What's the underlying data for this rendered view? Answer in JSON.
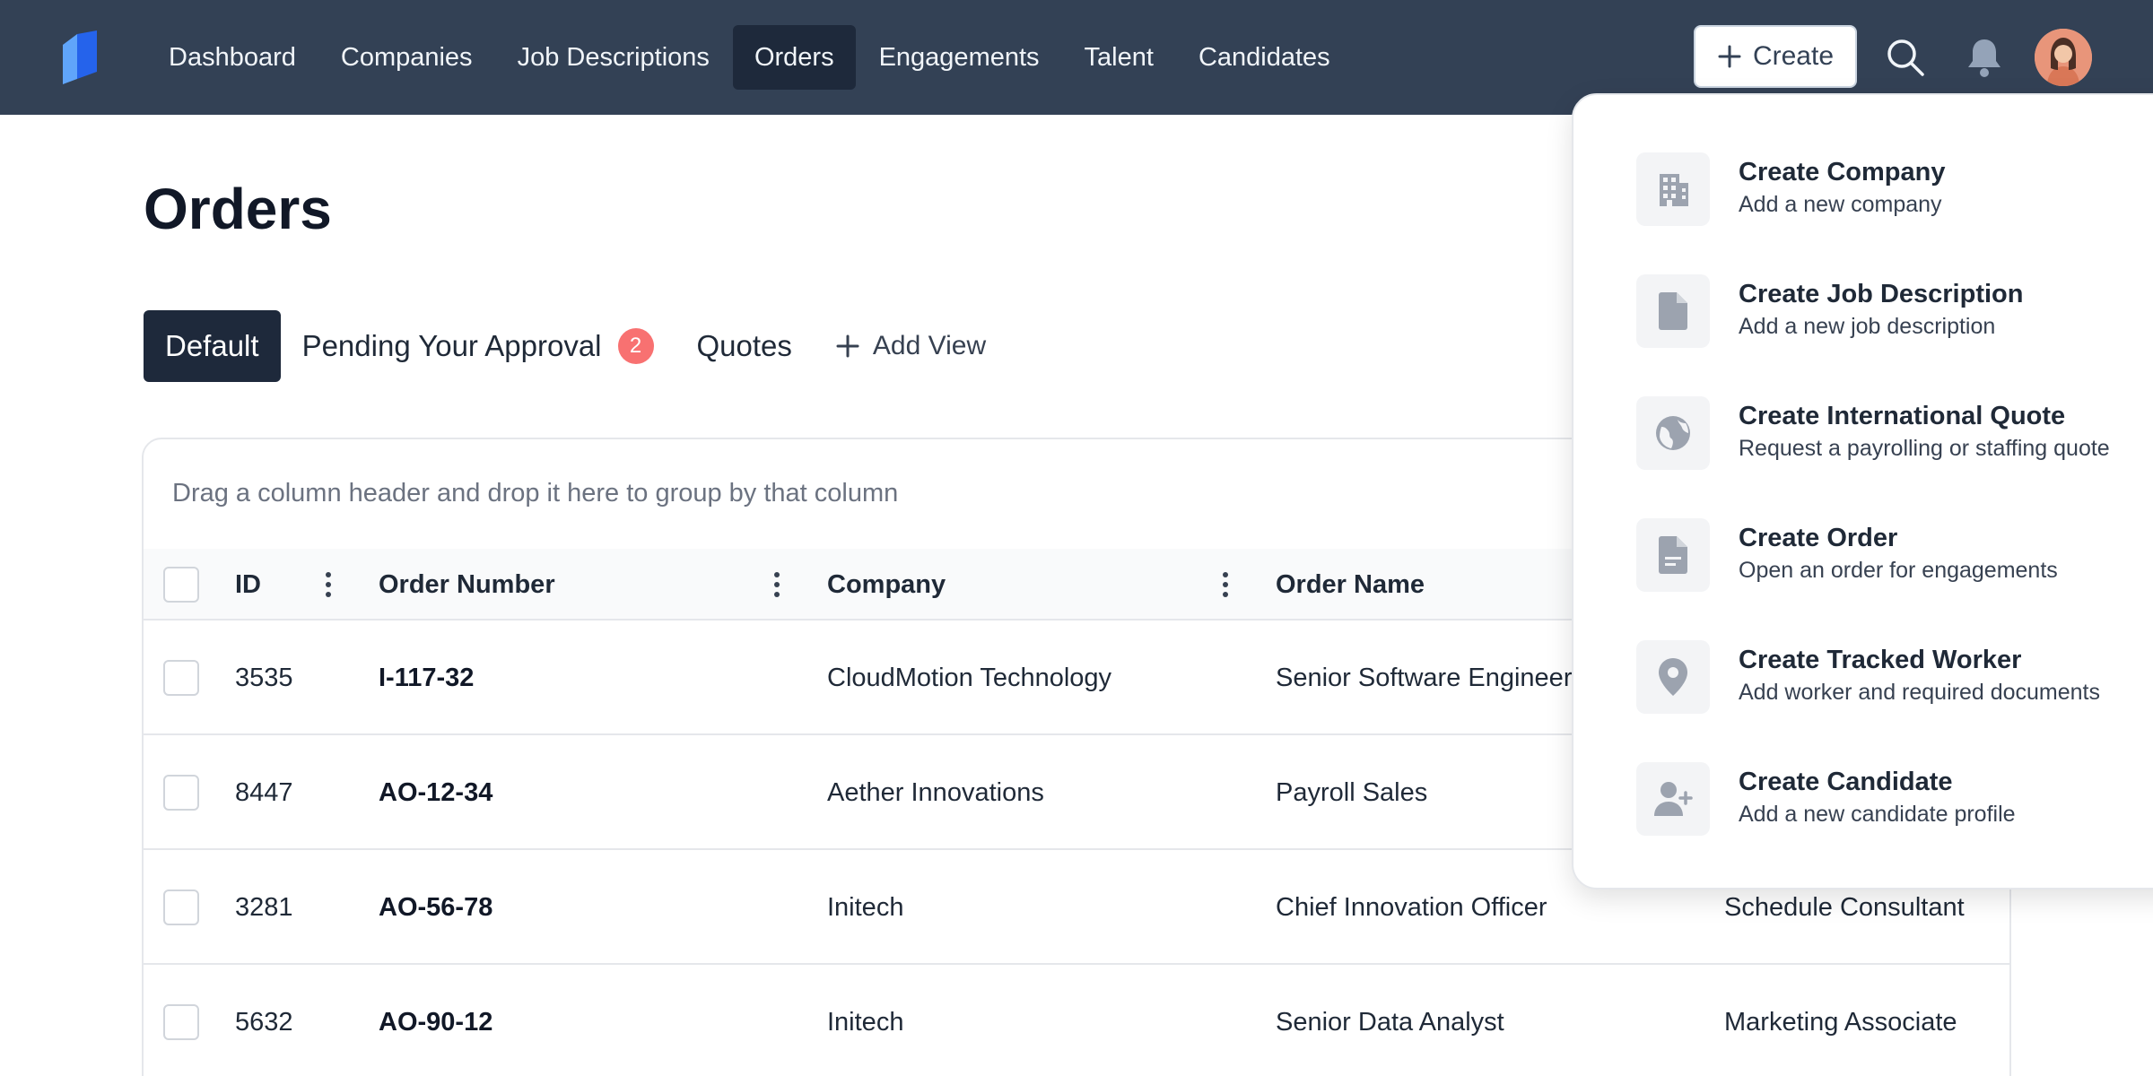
{
  "nav": {
    "items": [
      "Dashboard",
      "Companies",
      "Job Descriptions",
      "Orders",
      "Engagements",
      "Talent",
      "Candidates"
    ],
    "active": "Orders",
    "create_label": "Create"
  },
  "page": {
    "title": "Orders"
  },
  "views": {
    "tabs": [
      "Default",
      "Pending Your Approval",
      "Quotes"
    ],
    "pending_count": "2",
    "add_view_label": "Add View"
  },
  "grid": {
    "group_hint": "Drag a column header and drop it here to group by that column",
    "columns": [
      "ID",
      "Order Number",
      "Company",
      "Order Name"
    ],
    "rows": [
      {
        "id": "3535",
        "order_number": "I-117-32",
        "company": "CloudMotion Technology",
        "order_name": "Senior Software Engineer",
        "extra": ""
      },
      {
        "id": "8447",
        "order_number": "AO-12-34",
        "company": "Aether Innovations",
        "order_name": "Payroll Sales",
        "extra": ""
      },
      {
        "id": "3281",
        "order_number": "AO-56-78",
        "company": "Initech",
        "order_name": "Chief Innovation Officer",
        "extra": "Schedule Consultant"
      },
      {
        "id": "5632",
        "order_number": "AO-90-12",
        "company": "Initech",
        "order_name": "Senior Data Analyst",
        "extra": "Marketing Associate"
      }
    ]
  },
  "create_menu": {
    "items": [
      {
        "title": "Create Company",
        "subtitle": "Add a new company",
        "icon": "building-icon"
      },
      {
        "title": "Create Job Description",
        "subtitle": "Add a new job description",
        "icon": "document-icon"
      },
      {
        "title": "Create International Quote",
        "subtitle": "Request a payrolling or staffing quote",
        "icon": "globe-icon"
      },
      {
        "title": "Create Order",
        "subtitle": "Open an order for engagements",
        "icon": "document-text-icon"
      },
      {
        "title": "Create Tracked Worker",
        "subtitle": "Add worker and required documents",
        "icon": "location-pin-icon"
      },
      {
        "title": "Create Candidate",
        "subtitle": "Add a new candidate profile",
        "icon": "user-plus-icon"
      }
    ]
  },
  "colors": {
    "nav_bg": "#334155",
    "active_dark": "#1e293b",
    "badge": "#f87171",
    "icon_gray": "#9ca3af"
  }
}
